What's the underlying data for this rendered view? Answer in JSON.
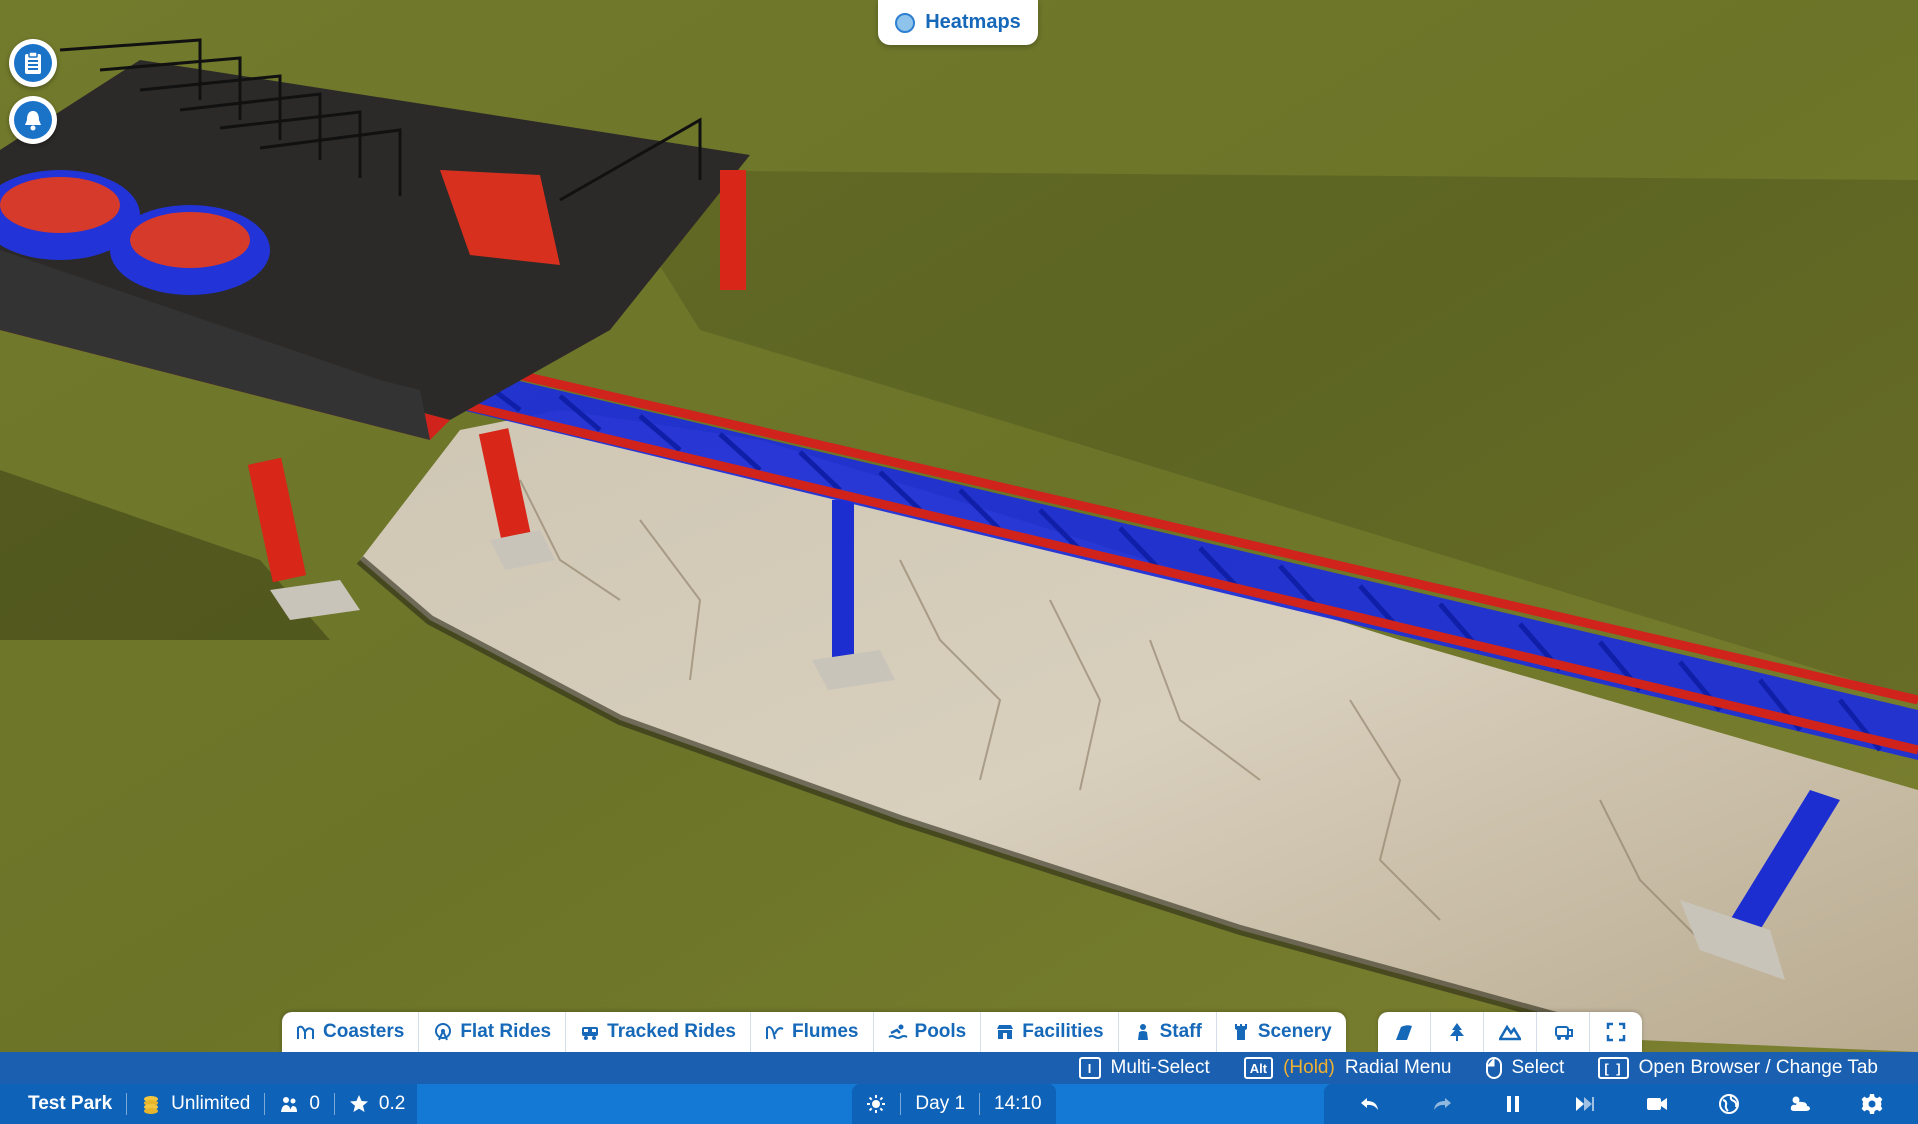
{
  "heatmaps": {
    "label": "Heatmaps"
  },
  "left_buttons": [
    {
      "icon": "clipboard-icon"
    },
    {
      "icon": "bell-icon"
    }
  ],
  "tabs": [
    {
      "label": "Coasters",
      "icon": "coaster-icon"
    },
    {
      "label": "Flat Rides",
      "icon": "ferris-wheel-icon"
    },
    {
      "label": "Tracked Rides",
      "icon": "train-icon"
    },
    {
      "label": "Flumes",
      "icon": "flume-icon"
    },
    {
      "label": "Pools",
      "icon": "swimmer-icon"
    },
    {
      "label": "Facilities",
      "icon": "shop-icon"
    },
    {
      "label": "Staff",
      "icon": "person-icon"
    },
    {
      "label": "Scenery",
      "icon": "tower-icon"
    }
  ],
  "tools": [
    {
      "icon": "terrain-paint-icon"
    },
    {
      "icon": "tree-icon"
    },
    {
      "icon": "mountain-icon"
    },
    {
      "icon": "vehicle-icon"
    },
    {
      "icon": "expand-icon"
    }
  ],
  "hints": [
    {
      "key": "I",
      "hold": "",
      "action": "Multi-Select"
    },
    {
      "key": "Alt",
      "hold": "(Hold)",
      "action": "Radial Menu"
    },
    {
      "key": "mouse",
      "hold": "",
      "action": "Select"
    },
    {
      "key": "[ ]",
      "hold": "",
      "action": "Open Browser / Change Tab"
    }
  ],
  "park": {
    "name": "Test Park",
    "money": "Unlimited",
    "guests": "0",
    "rating": "0.2"
  },
  "time": {
    "day": "Day 1",
    "clock": "14:10"
  },
  "colors": {
    "ui_blue": "#1479d4",
    "ui_dark_blue": "#0e63b8",
    "tab_text": "#1668b8",
    "track_red": "#d0231c",
    "track_blue": "#1f2fd6",
    "grass": "#6b7428"
  }
}
